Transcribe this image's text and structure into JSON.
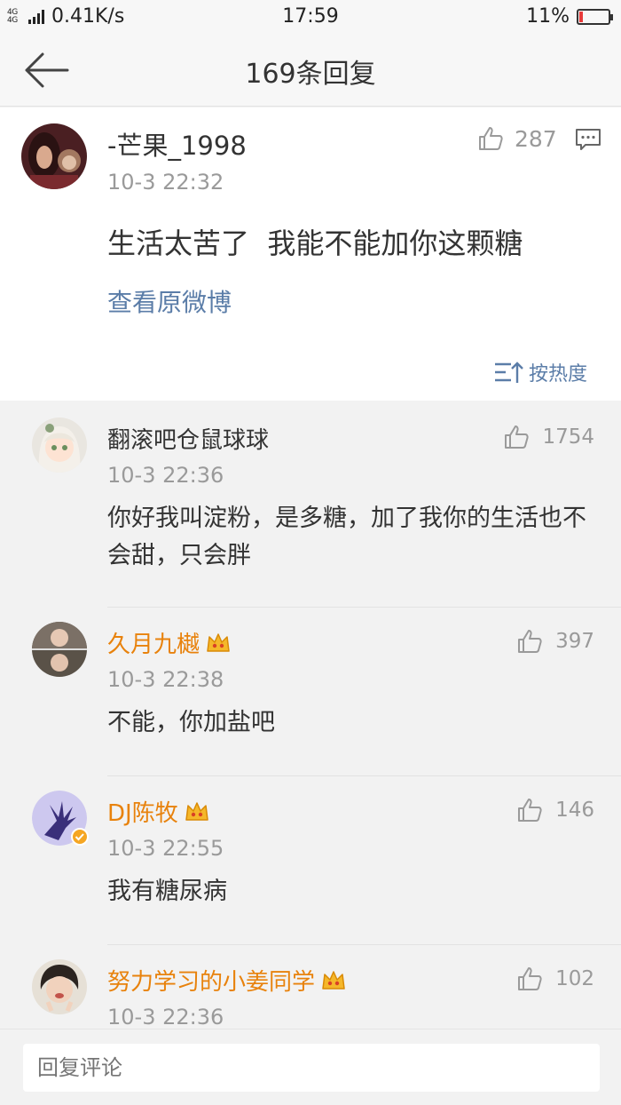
{
  "status_bar": {
    "network": "4G 4G",
    "speed": "0.41K/s",
    "time": "17:59",
    "battery": "11%",
    "battery_level": 0.11
  },
  "header": {
    "title": "169条回复",
    "back_icon": "arrow-left-icon"
  },
  "original_comment": {
    "username": "-芒果_1998",
    "time": "10-3 22:32",
    "likes": "287",
    "text": "生活太苦了  我能不能加你这颗糖",
    "view_original": "查看原微博",
    "sort_label": "按热度"
  },
  "replies": [
    {
      "username": "翻滚吧仓鼠球球",
      "vip": false,
      "time": "10-3 22:36",
      "likes": "1754",
      "text": "你好我叫淀粉，是多糖，加了我你的生活也不会甜，只会胖"
    },
    {
      "username": "久月九樾",
      "vip": true,
      "time": "10-3 22:38",
      "likes": "397",
      "text": "不能，你加盐吧"
    },
    {
      "username": "DJ陈牧",
      "vip": true,
      "verified": true,
      "time": "10-3 22:55",
      "likes": "146",
      "text": "我有糖尿病"
    },
    {
      "username": "努力学习的小姜同学",
      "vip": true,
      "time": "10-3 22:36",
      "likes": "102",
      "text": ""
    }
  ],
  "bottom_bar": {
    "placeholder": "回复评论"
  },
  "colors": {
    "link": "#5b7da8",
    "vip_name": "#e8820c",
    "muted": "#9a9a9a"
  }
}
